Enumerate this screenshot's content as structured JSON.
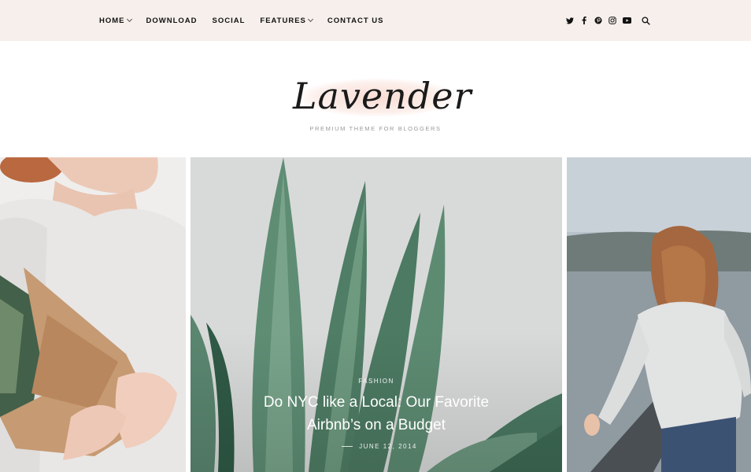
{
  "nav": {
    "items": [
      {
        "label": "HOME",
        "has_dropdown": true
      },
      {
        "label": "DOWNLOAD",
        "has_dropdown": false
      },
      {
        "label": "SOCIAL",
        "has_dropdown": false
      },
      {
        "label": "FEATURES",
        "has_dropdown": true
      },
      {
        "label": "CONTACT US",
        "has_dropdown": false
      }
    ]
  },
  "social": {
    "icons": [
      "twitter-icon",
      "facebook-icon",
      "pinterest-icon",
      "instagram-icon",
      "youtube-icon"
    ],
    "search_icon": "search-icon"
  },
  "header": {
    "logo": "Lavender",
    "tagline": "PREMIUM THEME FOR BLOGGERS"
  },
  "slider": {
    "featured": {
      "category": "FASHION",
      "title_line1": "Do NYC like a Local: Our Favorite",
      "title_line2": "Airbnb’s on a Budget",
      "date": "JUNE 12, 2014"
    }
  },
  "colors": {
    "topbar_bg": "#f6efeb",
    "logo_blush": "#f8d6cc",
    "text_dark": "#111111",
    "tagline_gray": "#9a9a9a"
  }
}
